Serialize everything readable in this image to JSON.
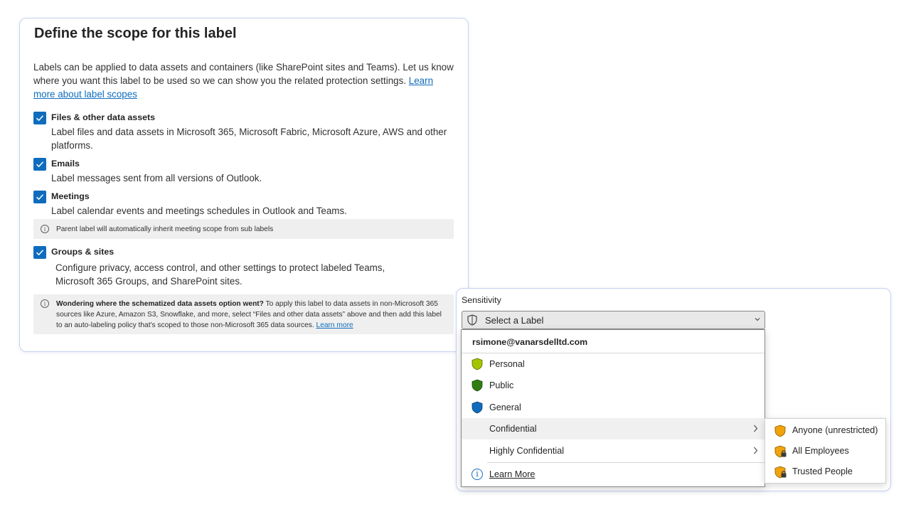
{
  "scope": {
    "title": "Define the scope for this label",
    "description": "Labels can be applied to data assets and containers (like SharePoint sites and Teams). Let us know where you want this label to be used so we can show you the related protection settings.",
    "learn_link": "Learn more about label scopes",
    "options": [
      {
        "title": "Files & other data assets",
        "description": "Label files and data assets in Microsoft 365, Microsoft Fabric, Microsoft Azure, AWS and other platforms.",
        "checked": true
      },
      {
        "title": "Emails",
        "description": "Label messages sent from all versions of Outlook.",
        "checked": true
      },
      {
        "title": "Meetings",
        "description": "Label calendar events and meetings schedules in Outlook and Teams.",
        "checked": true
      },
      {
        "title": "Groups & sites",
        "description": "Configure privacy, access control, and other settings to protect labeled Teams, Microsoft 365 Groups, and SharePoint sites.",
        "checked": true
      }
    ],
    "meeting_info": "Parent label will automatically inherit meeting scope from sub labels",
    "schema_info": {
      "bold": "Wondering where the schematized data assets option went?",
      "text": " To apply this label to data assets in non-Microsoft 365 sources like Azure, Amazon S3, Snowflake, and more, select “Files and other data assets” above and then add this label to an auto-labeling policy that's scoped to those non-Microsoft 365 data sources. ",
      "link": "Learn more"
    }
  },
  "sensitivity": {
    "label": "Sensitivity",
    "select_placeholder": "Select a Label",
    "account": "rsimone@vanarsdelltd.com",
    "items": [
      {
        "label": "Personal",
        "icon": "shield-icon",
        "color": "#a4c400"
      },
      {
        "label": "Public",
        "icon": "shield-icon",
        "color": "#2f7d13"
      },
      {
        "label": "General",
        "icon": "shield-icon",
        "color": "#0f6cbd"
      },
      {
        "label": "Confidential",
        "has_submenu": true
      },
      {
        "label": "Highly Confidential",
        "has_submenu": true
      }
    ],
    "learn_more": "Learn More",
    "submenu": [
      {
        "label": "Anyone (unrestricted)",
        "icon": "shield-icon",
        "color": "#f0a30a"
      },
      {
        "label": "All Employees",
        "icon": "shield-lock-icon",
        "color": "#f0a30a"
      },
      {
        "label": "Trusted People",
        "icon": "shield-lock-icon",
        "color": "#f0a30a"
      }
    ]
  },
  "colors": {
    "accent": "#0f6cbd",
    "card_border": "#c7d2f0"
  }
}
